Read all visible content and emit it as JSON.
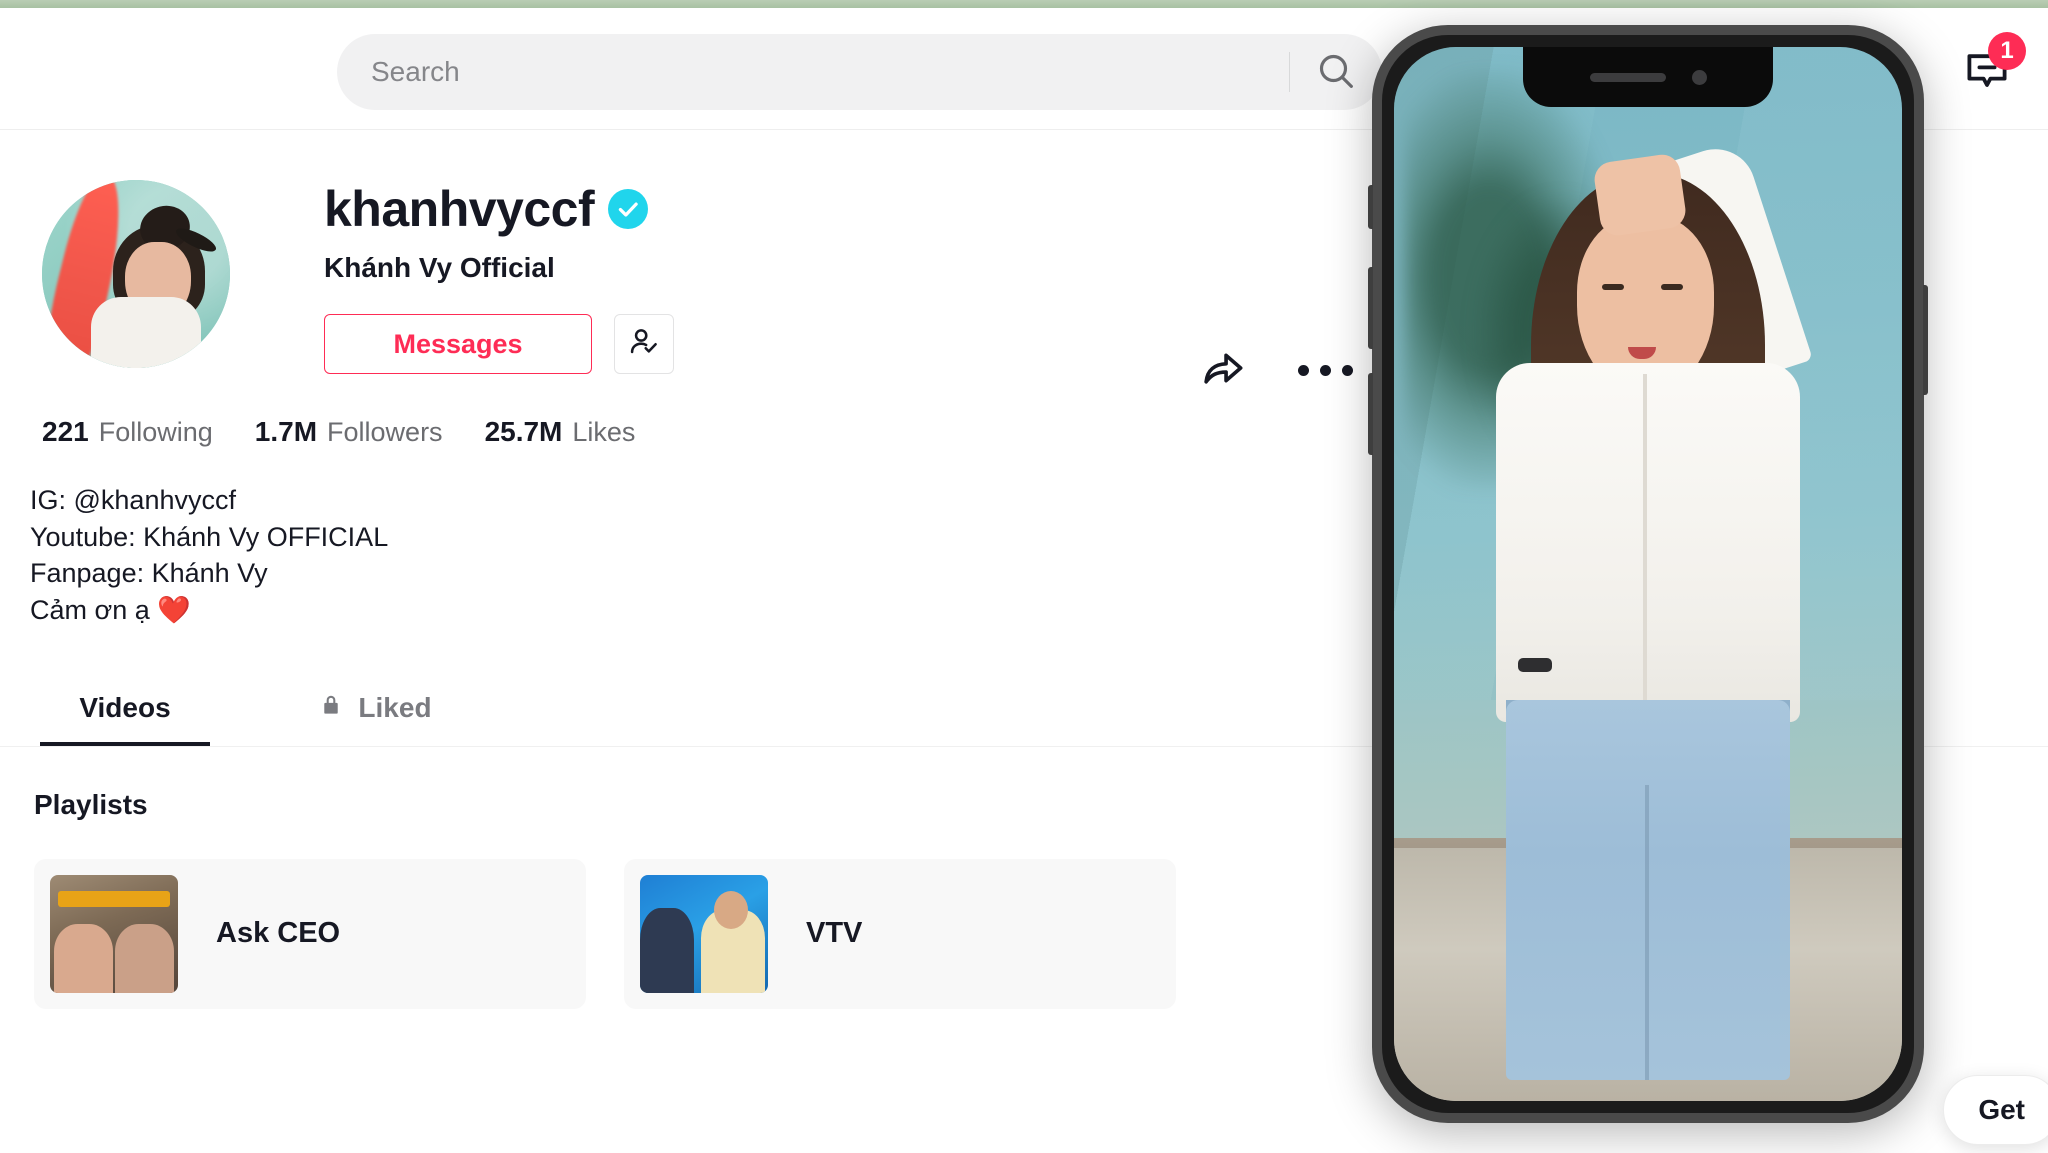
{
  "colors": {
    "brand_red": "#FE2C55",
    "verified_blue": "#20D5EC",
    "text_primary": "#161823",
    "text_secondary": "#6B6C70",
    "search_bg": "#F1F1F2",
    "top_strip_green": "#B9CDB4"
  },
  "header": {
    "search": {
      "placeholder": "Search",
      "value": "",
      "search_icon": "search-icon"
    },
    "notifications": {
      "icon": "message-icon",
      "badge_count": "1"
    }
  },
  "profile": {
    "avatar_alt": "khanhvyccf profile photo",
    "username": "khanhvyccf",
    "verified": true,
    "verified_icon": "verified-check-icon",
    "display_name": "Khánh Vy Official",
    "messages_button": "Messages",
    "follow_state_icon": "person-check-icon",
    "share_icon": "share-arrow-icon",
    "more_icon": "more-dots-icon",
    "stats": [
      {
        "value": "221",
        "label": "Following"
      },
      {
        "value": "1.7M",
        "label": "Followers"
      },
      {
        "value": "25.7M",
        "label": "Likes"
      }
    ],
    "bio_lines": [
      "IG: @khanhvyccf",
      "Youtube: Khánh Vy OFFICIAL",
      "Fanpage: Khánh Vy",
      "Cảm ơn ạ ❤️"
    ]
  },
  "tabs": [
    {
      "label": "Videos",
      "active": true,
      "icon": null
    },
    {
      "label": "Liked",
      "active": false,
      "icon": "lock-icon"
    }
  ],
  "playlists": {
    "section_title": "Playlists",
    "items": [
      {
        "name": "Ask CEO",
        "thumb": "ask-ceo-thumb"
      },
      {
        "name": "VTV",
        "thumb": "vtv-thumb"
      }
    ]
  },
  "phone_overlay": {
    "alt": "phone mockup showing video of woman in white shirt and light blue jeans",
    "notch_icons": [
      "speaker-grille",
      "front-camera"
    ]
  },
  "floating": {
    "get_app_label": "Get"
  }
}
